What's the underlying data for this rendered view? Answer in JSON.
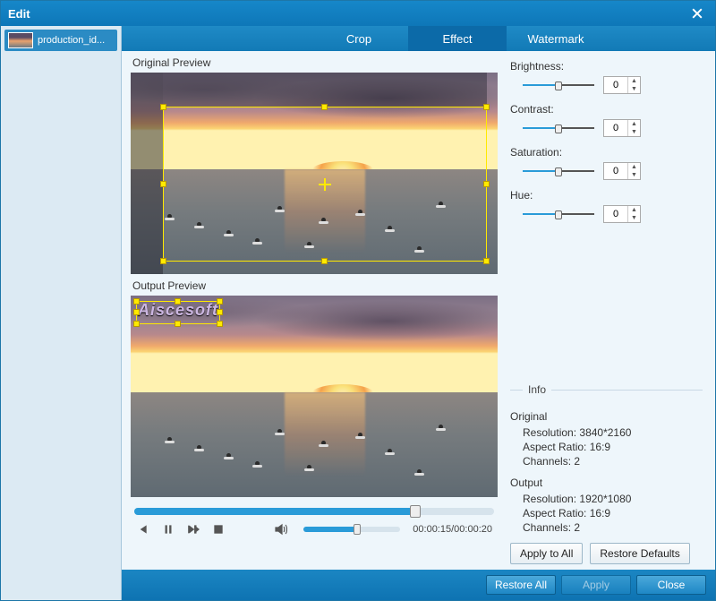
{
  "window": {
    "title": "Edit"
  },
  "sidebar": {
    "items": [
      {
        "label": "production_id..."
      }
    ]
  },
  "tabs": [
    {
      "id": "crop",
      "label": "Crop",
      "active": false
    },
    {
      "id": "effect",
      "label": "Effect",
      "active": true
    },
    {
      "id": "watermark",
      "label": "Watermark",
      "active": false
    }
  ],
  "preview": {
    "original_label": "Original Preview",
    "output_label": "Output Preview",
    "watermark_text": "Aiscesoft"
  },
  "playback": {
    "current": "00:00:15",
    "total": "00:00:20",
    "sep": "/"
  },
  "effects": {
    "brightness": {
      "label": "Brightness:",
      "value": "0"
    },
    "contrast": {
      "label": "Contrast:",
      "value": "0"
    },
    "saturation": {
      "label": "Saturation:",
      "value": "0"
    },
    "hue": {
      "label": "Hue:",
      "value": "0"
    }
  },
  "info": {
    "title": "Info",
    "original": {
      "header": "Original",
      "resolution_label": "Resolution:",
      "resolution": "3840*2160",
      "aspect_label": "Aspect Ratio:",
      "aspect": "16:9",
      "channels_label": "Channels:",
      "channels": "2"
    },
    "output": {
      "header": "Output",
      "resolution_label": "Resolution:",
      "resolution": "1920*1080",
      "aspect_label": "Aspect Ratio:",
      "aspect": "16:9",
      "channels_label": "Channels:",
      "channels": "2"
    }
  },
  "panel_buttons": {
    "apply_all": "Apply to All",
    "restore_defaults": "Restore Defaults"
  },
  "footer": {
    "restore_all": "Restore All",
    "apply": "Apply",
    "close": "Close"
  }
}
